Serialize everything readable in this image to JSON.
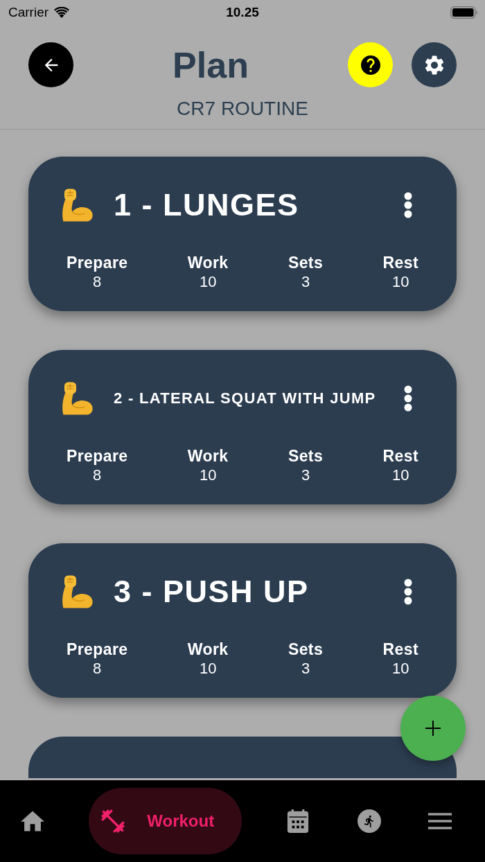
{
  "status_bar": {
    "carrier": "Carrier",
    "time": "10.25"
  },
  "header": {
    "title": "Plan",
    "subtitle": "CR7 ROUTINE"
  },
  "exercises": [
    {
      "title": "1 - LUNGES",
      "stats": [
        {
          "label": "Prepare",
          "value": "8"
        },
        {
          "label": "Work",
          "value": "10"
        },
        {
          "label": "Sets",
          "value": "3"
        },
        {
          "label": "Rest",
          "value": "10"
        }
      ]
    },
    {
      "title": "2 - LATERAL SQUAT WITH JUMP",
      "stats": [
        {
          "label": "Prepare",
          "value": "8"
        },
        {
          "label": "Work",
          "value": "10"
        },
        {
          "label": "Sets",
          "value": "3"
        },
        {
          "label": "Rest",
          "value": "10"
        }
      ]
    },
    {
      "title": "3 - PUSH UP",
      "stats": [
        {
          "label": "Prepare",
          "value": "8"
        },
        {
          "label": "Work",
          "value": "10"
        },
        {
          "label": "Sets",
          "value": "3"
        },
        {
          "label": "Rest",
          "value": "10"
        }
      ]
    }
  ],
  "bottom_nav": {
    "items": [
      {
        "selected": false
      },
      {
        "label": "Workout",
        "selected": true
      },
      {
        "selected": false
      },
      {
        "selected": false
      },
      {
        "selected": false
      }
    ]
  }
}
